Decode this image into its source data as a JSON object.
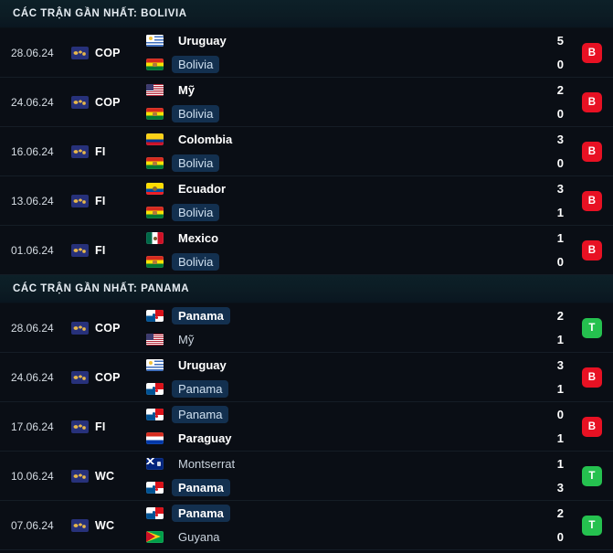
{
  "sections": [
    {
      "title": "CÁC TRẬN GẦN NHẤT: BOLIVIA",
      "highlight_team": "Bolivia",
      "matches": [
        {
          "date": "28.06.24",
          "competition": "COP",
          "competition_icon": "world-map-icon",
          "home": {
            "name": "Uruguay",
            "flag": "uruguay",
            "score": "5",
            "highlight": false,
            "bold": true
          },
          "away": {
            "name": "Bolivia",
            "flag": "bolivia",
            "score": "0",
            "highlight": true,
            "bold": false
          },
          "result": {
            "label": "B",
            "type": "loss"
          }
        },
        {
          "date": "24.06.24",
          "competition": "COP",
          "competition_icon": "world-map-icon",
          "home": {
            "name": "Mỹ",
            "flag": "usa",
            "score": "2",
            "highlight": false,
            "bold": true
          },
          "away": {
            "name": "Bolivia",
            "flag": "bolivia",
            "score": "0",
            "highlight": true,
            "bold": false
          },
          "result": {
            "label": "B",
            "type": "loss"
          }
        },
        {
          "date": "16.06.24",
          "competition": "FI",
          "competition_icon": "world-map-icon",
          "home": {
            "name": "Colombia",
            "flag": "colombia",
            "score": "3",
            "highlight": false,
            "bold": true
          },
          "away": {
            "name": "Bolivia",
            "flag": "bolivia",
            "score": "0",
            "highlight": true,
            "bold": false
          },
          "result": {
            "label": "B",
            "type": "loss"
          }
        },
        {
          "date": "13.06.24",
          "competition": "FI",
          "competition_icon": "world-map-icon",
          "home": {
            "name": "Ecuador",
            "flag": "ecuador",
            "score": "3",
            "highlight": false,
            "bold": true
          },
          "away": {
            "name": "Bolivia",
            "flag": "bolivia",
            "score": "1",
            "highlight": true,
            "bold": false
          },
          "result": {
            "label": "B",
            "type": "loss"
          }
        },
        {
          "date": "01.06.24",
          "competition": "FI",
          "competition_icon": "world-map-icon",
          "home": {
            "name": "Mexico",
            "flag": "mexico",
            "score": "1",
            "highlight": false,
            "bold": true
          },
          "away": {
            "name": "Bolivia",
            "flag": "bolivia",
            "score": "0",
            "highlight": true,
            "bold": false
          },
          "result": {
            "label": "B",
            "type": "loss"
          }
        }
      ]
    },
    {
      "title": "CÁC TRẬN GẦN NHẤT: PANAMA",
      "highlight_team": "Panama",
      "matches": [
        {
          "date": "28.06.24",
          "competition": "COP",
          "competition_icon": "world-map-icon",
          "home": {
            "name": "Panama",
            "flag": "panama",
            "score": "2",
            "highlight": true,
            "bold": true
          },
          "away": {
            "name": "Mỹ",
            "flag": "usa",
            "score": "1",
            "highlight": false,
            "bold": false
          },
          "result": {
            "label": "T",
            "type": "win"
          }
        },
        {
          "date": "24.06.24",
          "competition": "COP",
          "competition_icon": "world-map-icon",
          "home": {
            "name": "Uruguay",
            "flag": "uruguay",
            "score": "3",
            "highlight": false,
            "bold": true
          },
          "away": {
            "name": "Panama",
            "flag": "panama",
            "score": "1",
            "highlight": true,
            "bold": false
          },
          "result": {
            "label": "B",
            "type": "loss"
          }
        },
        {
          "date": "17.06.24",
          "competition": "FI",
          "competition_icon": "world-map-icon",
          "home": {
            "name": "Panama",
            "flag": "panama",
            "score": "0",
            "highlight": true,
            "bold": false
          },
          "away": {
            "name": "Paraguay",
            "flag": "paraguay",
            "score": "1",
            "highlight": false,
            "bold": true
          },
          "result": {
            "label": "B",
            "type": "loss"
          }
        },
        {
          "date": "10.06.24",
          "competition": "WC",
          "competition_icon": "world-map-icon",
          "home": {
            "name": "Montserrat",
            "flag": "montserrat",
            "score": "1",
            "highlight": false,
            "bold": false
          },
          "away": {
            "name": "Panama",
            "flag": "panama",
            "score": "3",
            "highlight": true,
            "bold": true
          },
          "result": {
            "label": "T",
            "type": "win"
          }
        },
        {
          "date": "07.06.24",
          "competition": "WC",
          "competition_icon": "world-map-icon",
          "home": {
            "name": "Panama",
            "flag": "panama",
            "score": "2",
            "highlight": true,
            "bold": true
          },
          "away": {
            "name": "Guyana",
            "flag": "guyana",
            "score": "0",
            "highlight": false,
            "bold": false
          },
          "result": {
            "label": "T",
            "type": "win"
          }
        }
      ]
    }
  ],
  "colors": {
    "background": "#0a0e15",
    "header_background": "#0d2028",
    "highlight_pill": "#13304f",
    "loss_badge": "#e81123",
    "win_badge": "#25c14f",
    "text_primary": "#ffffff",
    "text_secondary": "#c9d3dd",
    "divider": "#151d26"
  }
}
